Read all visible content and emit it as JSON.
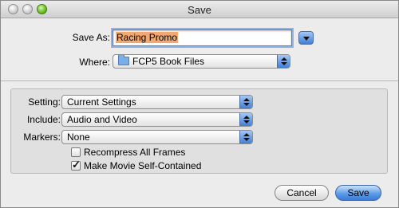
{
  "window": {
    "title": "Save"
  },
  "save_as": {
    "label": "Save As:",
    "value": "Racing Promo"
  },
  "where": {
    "label": "Where:",
    "value": "FCP5 Book Files",
    "icon": "folder-icon"
  },
  "options": {
    "setting": {
      "label": "Setting:",
      "value": "Current Settings"
    },
    "include": {
      "label": "Include:",
      "value": "Audio and Video"
    },
    "markers": {
      "label": "Markers:",
      "value": "None"
    },
    "recompress": {
      "label": "Recompress All Frames",
      "checked": false
    },
    "self_contained": {
      "label": "Make Movie Self-Contained",
      "checked": true,
      "mark": "✓"
    }
  },
  "buttons": {
    "cancel": "Cancel",
    "save": "Save"
  },
  "colors": {
    "accent": "#3f7fd6",
    "selection": "#f2a86f"
  }
}
